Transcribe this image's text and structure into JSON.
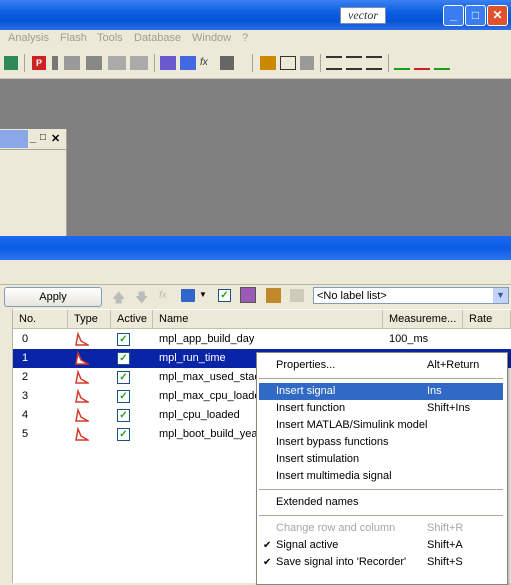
{
  "app": {
    "brand": "vector",
    "window_buttons": [
      "_",
      "□",
      "✕"
    ]
  },
  "menu": {
    "items": [
      "Analysis",
      "Flash",
      "Tools",
      "Database",
      "Window",
      "?"
    ]
  },
  "mdi_child": {
    "buttons": [
      "_",
      "□",
      "✕"
    ]
  },
  "toolbar2": {
    "apply_label": "Apply",
    "label_list_value": "<No label list>"
  },
  "table": {
    "headers": [
      "No.",
      "Type",
      "Active",
      "Name",
      "Measureme...",
      "Rate"
    ],
    "rows": [
      {
        "no": "0",
        "active": true,
        "name": "mpl_app_build_day",
        "measure": "100_ms",
        "selected": false
      },
      {
        "no": "1",
        "active": true,
        "name": "mpl_run_time",
        "measure": "",
        "selected": true
      },
      {
        "no": "2",
        "active": true,
        "name": "mpl_max_used_stac",
        "measure": "",
        "selected": false
      },
      {
        "no": "3",
        "active": true,
        "name": "mpl_max_cpu_loade",
        "measure": "",
        "selected": false
      },
      {
        "no": "4",
        "active": true,
        "name": "mpl_cpu_loaded",
        "measure": "",
        "selected": false
      },
      {
        "no": "5",
        "active": true,
        "name": "mpl_boot_build_yea",
        "measure": "",
        "selected": false
      }
    ]
  },
  "context_menu": {
    "items": [
      {
        "label": "Properties...",
        "shortcut": "Alt+Return"
      },
      {
        "label": "Insert signal",
        "shortcut": "Ins"
      },
      {
        "label": "Insert function",
        "shortcut": "Shift+Ins"
      },
      {
        "label": "Insert MATLAB/Simulink model",
        "shortcut": ""
      },
      {
        "label": "Insert bypass functions",
        "shortcut": ""
      },
      {
        "label": "Insert stimulation",
        "shortcut": ""
      },
      {
        "label": "Insert multimedia signal",
        "shortcut": ""
      },
      {
        "label": "Extended names",
        "shortcut": ""
      },
      {
        "label": "Change row and column",
        "shortcut": "Shift+R"
      },
      {
        "label": "Signal active",
        "shortcut": "Shift+A"
      },
      {
        "label": "Save signal into 'Recorder'",
        "shortcut": "Shift+S"
      }
    ]
  },
  "colors": {
    "titlebar": "#0553d6",
    "selection": "#0a24a8",
    "menu_highlight": "#316ac5",
    "check_green": "#21a121",
    "type_icon_red": "#d43a2a"
  }
}
